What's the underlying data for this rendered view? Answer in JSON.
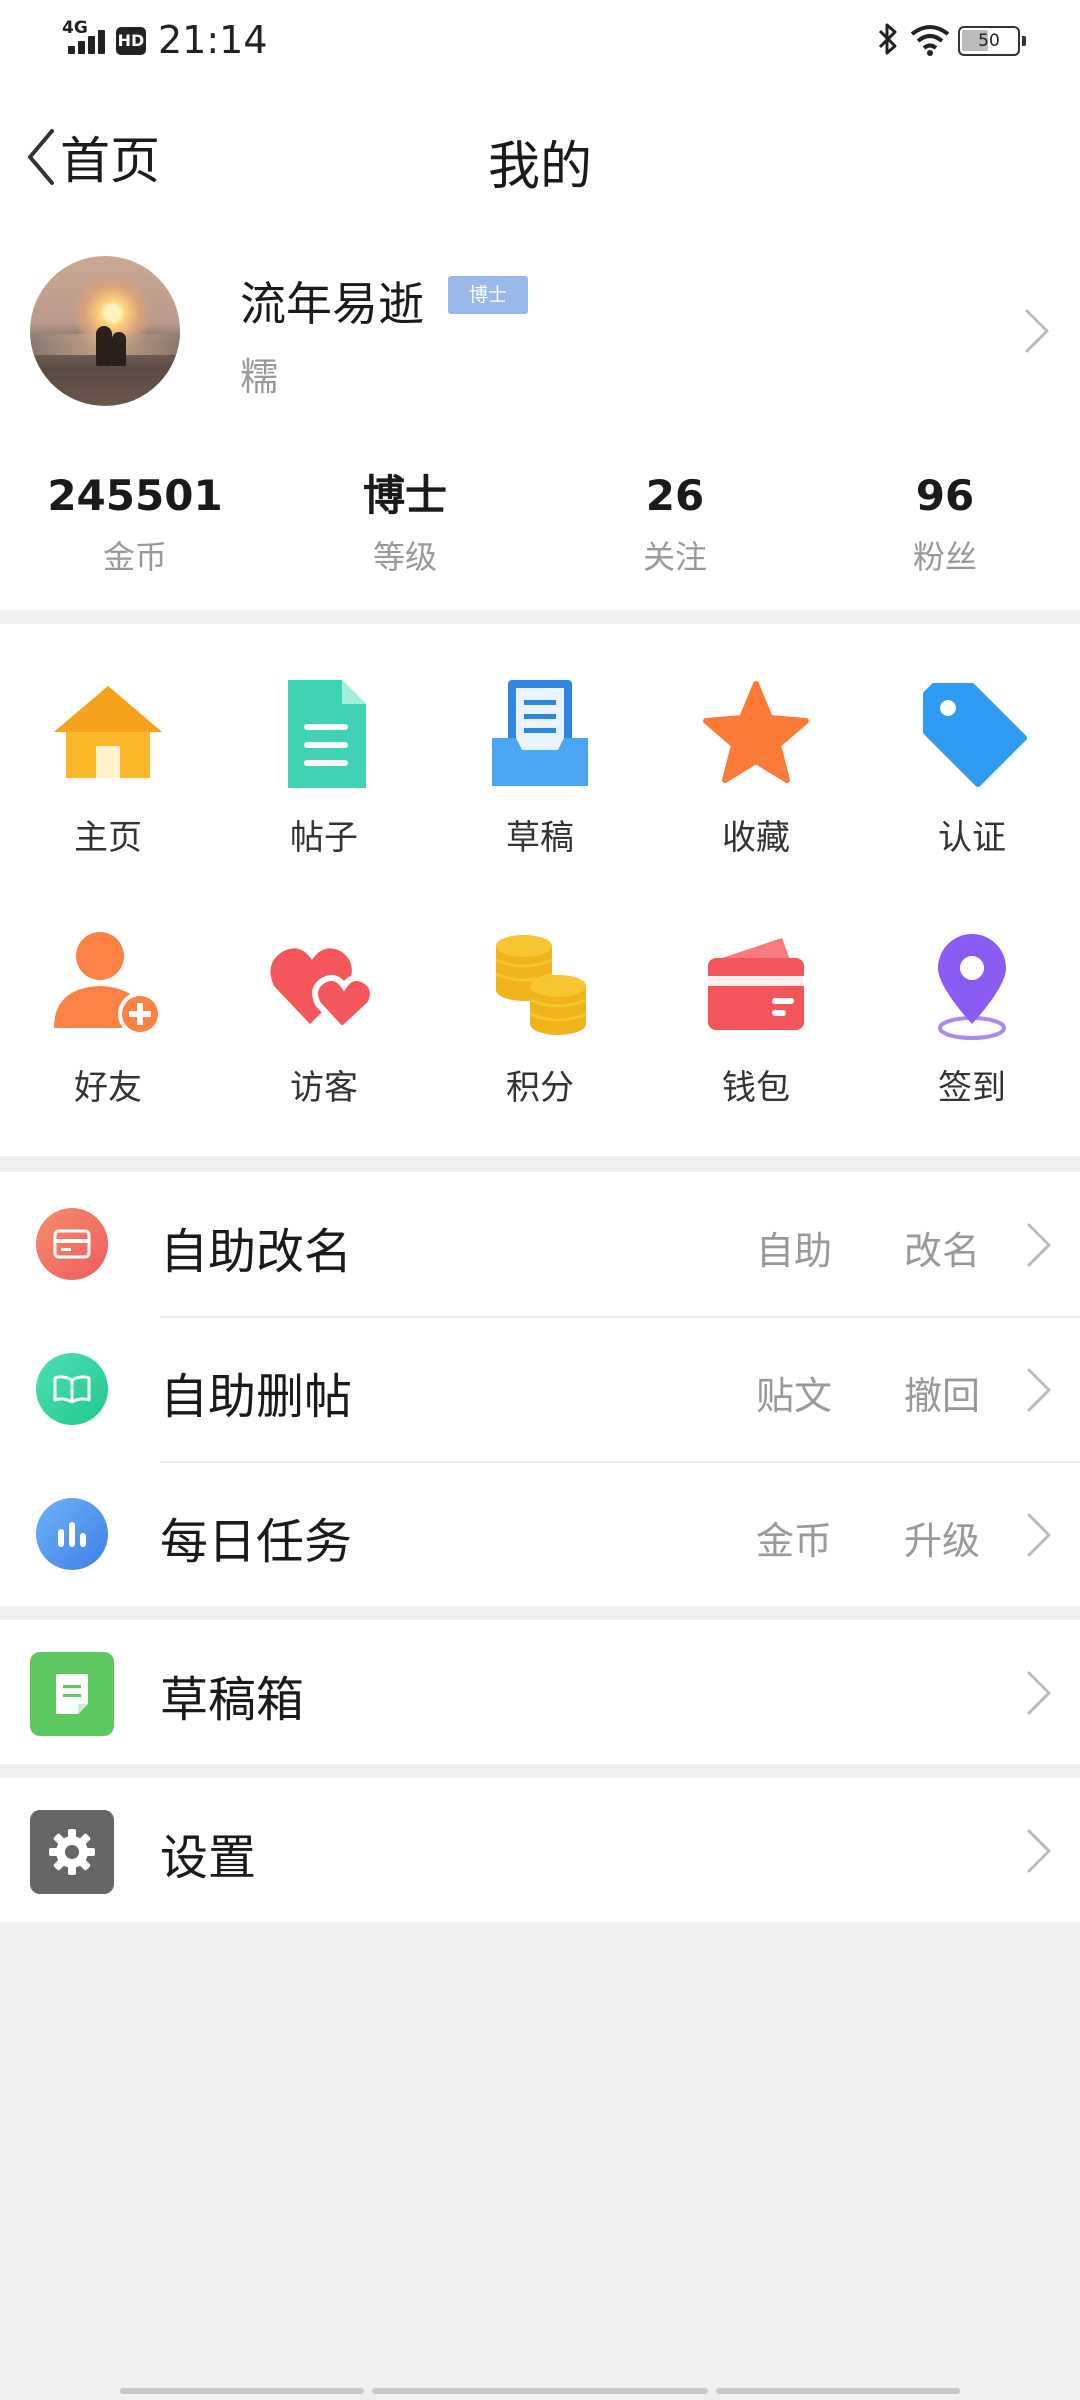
{
  "status_bar": {
    "network": "4G",
    "hd": "HD",
    "time": "21:14",
    "battery": "50"
  },
  "header": {
    "back_label": "首页",
    "title": "我的"
  },
  "profile": {
    "username": "流年易逝",
    "rank_badge": "博士",
    "subtitle": "糯"
  },
  "stats": [
    {
      "value": "245501",
      "label": "金币"
    },
    {
      "value": "博士",
      "label": "等级"
    },
    {
      "value": "26",
      "label": "关注"
    },
    {
      "value": "96",
      "label": "粉丝"
    }
  ],
  "grid": [
    {
      "label": "主页",
      "icon": "home-icon"
    },
    {
      "label": "帖子",
      "icon": "document-icon"
    },
    {
      "label": "草稿",
      "icon": "drafts-tray-icon"
    },
    {
      "label": "收藏",
      "icon": "star-icon"
    },
    {
      "label": "认证",
      "icon": "tag-icon"
    },
    {
      "label": "好友",
      "icon": "add-friend-icon"
    },
    {
      "label": "访客",
      "icon": "hearts-icon"
    },
    {
      "label": "积分",
      "icon": "coins-icon"
    },
    {
      "label": "钱包",
      "icon": "wallet-icon"
    },
    {
      "label": "签到",
      "icon": "location-pin-icon"
    }
  ],
  "list_main": [
    {
      "label": "自助改名",
      "tag1": "自助",
      "tag2": "改名",
      "icon": "card-icon",
      "color": "#f0675a"
    },
    {
      "label": "自助删帖",
      "tag1": "贴文",
      "tag2": "撤回",
      "icon": "book-icon",
      "color": "#2ed39a"
    },
    {
      "label": "每日任务",
      "tag1": "金币",
      "tag2": "升级",
      "icon": "bar-chart-icon",
      "color": "#4a90ee"
    }
  ],
  "list_drafts": {
    "label": "草稿箱",
    "icon": "draft-box-icon",
    "color": "#5cc85f"
  },
  "list_settings": {
    "label": "设置",
    "icon": "gear-icon",
    "color": "#666666"
  }
}
